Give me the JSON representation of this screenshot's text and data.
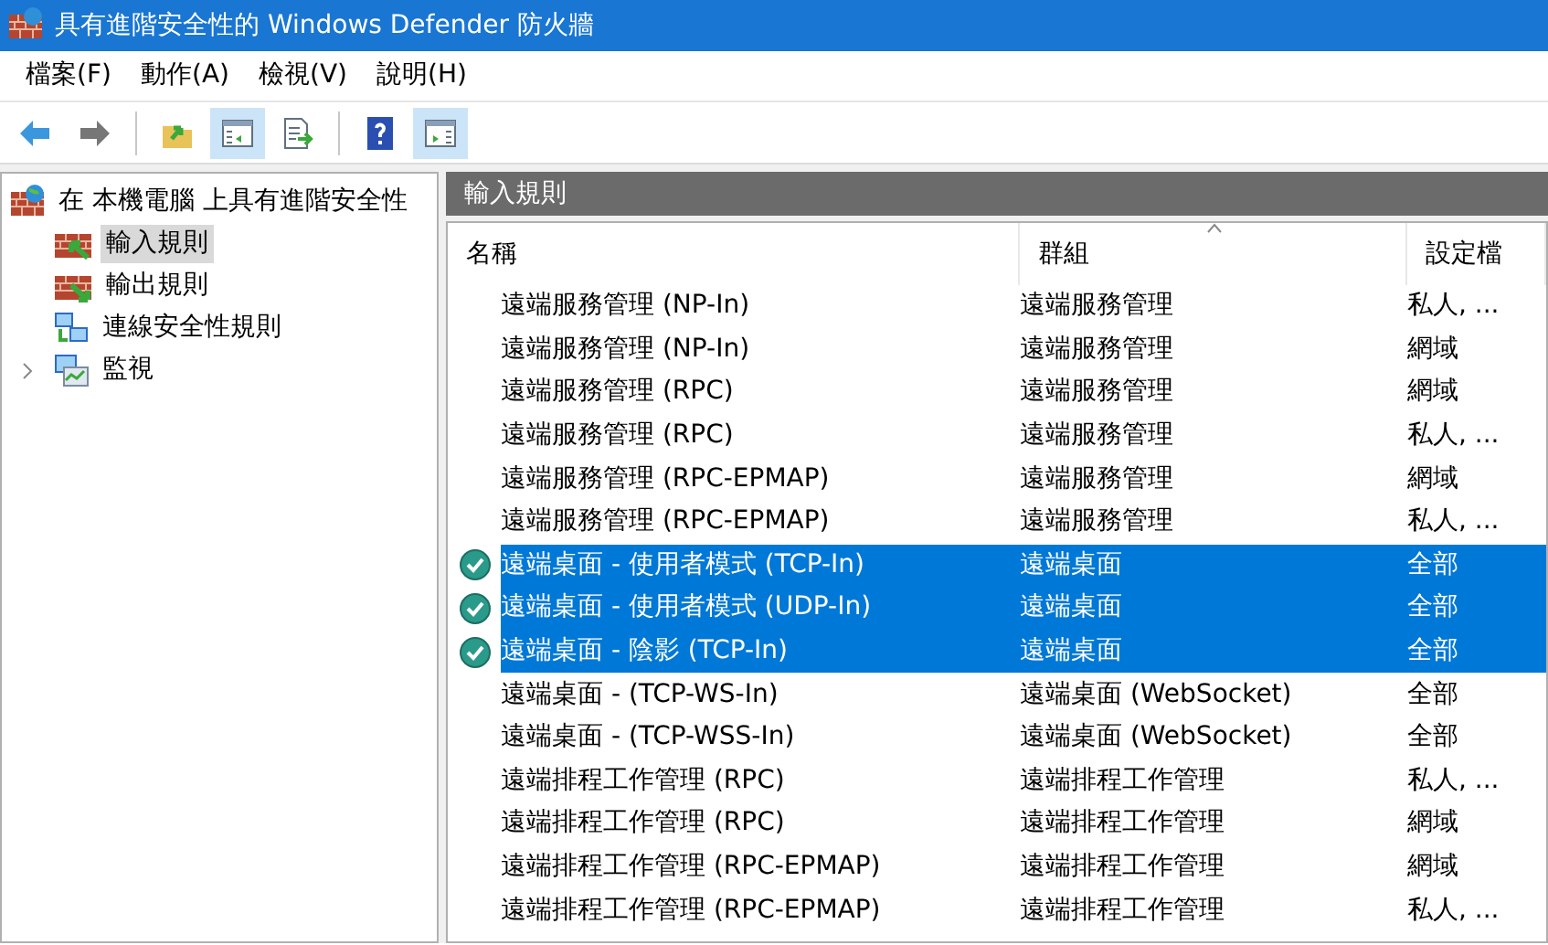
{
  "window": {
    "title": "具有進階安全性的 Windows Defender 防火牆"
  },
  "menu": [
    "檔案(F)",
    "動作(A)",
    "檢視(V)",
    "說明(H)"
  ],
  "toolbar": [
    {
      "kind": "back",
      "pressed": false
    },
    {
      "kind": "forward",
      "pressed": false
    },
    {
      "kind": "separator"
    },
    {
      "kind": "up",
      "pressed": false
    },
    {
      "kind": "tree",
      "pressed": true
    },
    {
      "kind": "export",
      "pressed": false
    },
    {
      "kind": "separator"
    },
    {
      "kind": "help",
      "pressed": false
    },
    {
      "kind": "action",
      "pressed": true
    }
  ],
  "tree": {
    "root": {
      "label": "在 本機電腦 上具有進階安全性",
      "kind": "firewall"
    },
    "children": [
      {
        "label": "輸入規則",
        "kind": "inbound",
        "selected": true,
        "has_children": false
      },
      {
        "label": "輸出規則",
        "kind": "outbound",
        "selected": false,
        "has_children": false
      },
      {
        "label": "連線安全性規則",
        "kind": "connection",
        "selected": false,
        "has_children": false
      },
      {
        "label": "監視",
        "kind": "monitor",
        "selected": false,
        "has_children": true
      }
    ]
  },
  "pane": {
    "title": "輸入規則",
    "columns": [
      "名稱",
      "群組",
      "設定檔"
    ],
    "rows": [
      {
        "name": "遠端服務管理 (NP-In)",
        "group": "遠端服務管理",
        "profile": "私人, ...",
        "enabled": false,
        "selected": false
      },
      {
        "name": "遠端服務管理 (NP-In)",
        "group": "遠端服務管理",
        "profile": "網域",
        "enabled": false,
        "selected": false
      },
      {
        "name": "遠端服務管理 (RPC)",
        "group": "遠端服務管理",
        "profile": "網域",
        "enabled": false,
        "selected": false
      },
      {
        "name": "遠端服務管理 (RPC)",
        "group": "遠端服務管理",
        "profile": "私人, ...",
        "enabled": false,
        "selected": false
      },
      {
        "name": "遠端服務管理 (RPC-EPMAP)",
        "group": "遠端服務管理",
        "profile": "網域",
        "enabled": false,
        "selected": false
      },
      {
        "name": "遠端服務管理 (RPC-EPMAP)",
        "group": "遠端服務管理",
        "profile": "私人, ...",
        "enabled": false,
        "selected": false
      },
      {
        "name": "遠端桌面 - 使用者模式 (TCP-In)",
        "group": "遠端桌面",
        "profile": "全部",
        "enabled": true,
        "selected": true
      },
      {
        "name": "遠端桌面 - 使用者模式 (UDP-In)",
        "group": "遠端桌面",
        "profile": "全部",
        "enabled": true,
        "selected": true
      },
      {
        "name": "遠端桌面 - 陰影 (TCP-In)",
        "group": "遠端桌面",
        "profile": "全部",
        "enabled": true,
        "selected": true
      },
      {
        "name": "遠端桌面 - (TCP-WS-In)",
        "group": "遠端桌面 (WebSocket)",
        "profile": "全部",
        "enabled": false,
        "selected": false
      },
      {
        "name": "遠端桌面 - (TCP-WSS-In)",
        "group": "遠端桌面 (WebSocket)",
        "profile": "全部",
        "enabled": false,
        "selected": false
      },
      {
        "name": "遠端排程工作管理 (RPC)",
        "group": "遠端排程工作管理",
        "profile": "私人, ...",
        "enabled": false,
        "selected": false
      },
      {
        "name": "遠端排程工作管理 (RPC)",
        "group": "遠端排程工作管理",
        "profile": "網域",
        "enabled": false,
        "selected": false
      },
      {
        "name": "遠端排程工作管理 (RPC-EPMAP)",
        "group": "遠端排程工作管理",
        "profile": "網域",
        "enabled": false,
        "selected": false
      },
      {
        "name": "遠端排程工作管理 (RPC-EPMAP)",
        "group": "遠端排程工作管理",
        "profile": "私人, ...",
        "enabled": false,
        "selected": false
      }
    ]
  }
}
